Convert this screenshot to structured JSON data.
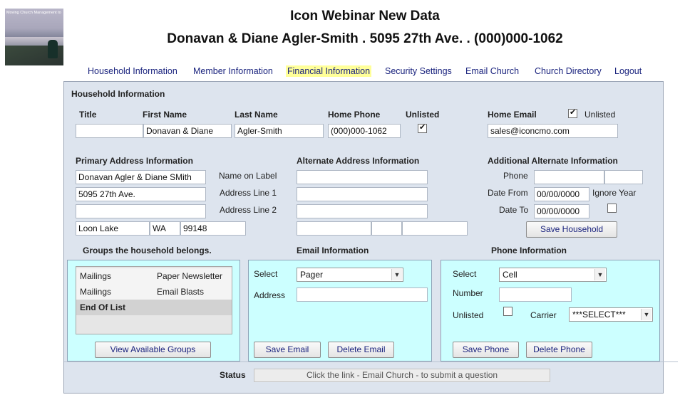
{
  "header": {
    "logo_caption": "Moving Church Management to a Higher Place",
    "title": "Icon Webinar New Data",
    "subtitle": "Donavan & Diane Agler-Smith . 5095 27th Ave. . (000)000-1062"
  },
  "nav": [
    {
      "label": "Household Information",
      "active": false
    },
    {
      "label": "Member Information",
      "active": false
    },
    {
      "label": "Financial Information",
      "active": true
    },
    {
      "label": "Security Settings",
      "active": false
    },
    {
      "label": "Email Church",
      "active": false
    },
    {
      "label": "Church Directory",
      "active": false
    },
    {
      "label": "Logout",
      "active": false
    }
  ],
  "household": {
    "section_title": "Household Information",
    "labels": {
      "title": "Title",
      "first_name": "First Name",
      "last_name": "Last Name",
      "home_phone": "Home Phone",
      "unlisted": "Unlisted",
      "home_email": "Home Email",
      "email_unlisted": "Unlisted"
    },
    "values": {
      "title": "",
      "first_name": "Donavan & Diane",
      "last_name": "Agler-Smith",
      "home_phone": "(000)000-1062",
      "phone_unlisted": true,
      "home_email": "sales@iconcmo.com",
      "email_unlisted": true
    }
  },
  "primary_address": {
    "section_title": "Primary Address Information",
    "name_on_label": "Donavan Agler & Diane SMith",
    "line1": "5095 27th Ave.",
    "line2": "",
    "city": "Loon Lake",
    "state": "WA",
    "zip": "99148"
  },
  "address_labels": {
    "name_on_label": "Name on Label",
    "line1": "Address Line 1",
    "line2": "Address Line 2"
  },
  "alternate_address": {
    "section_title": "Alternate Address Information",
    "name_on_label": "",
    "line1": "",
    "line2": "",
    "city": "",
    "state": "",
    "zip": ""
  },
  "additional_alternate": {
    "section_title": "Additional Alternate Information",
    "phone_label": "Phone",
    "phone": "",
    "phone_ext": "",
    "date_from_label": "Date From",
    "date_from": "00/00/0000",
    "ignore_year_label": "Ignore Year",
    "ignore_year": false,
    "date_to_label": "Date To",
    "date_to": "00/00/0000",
    "save_button": "Save Household"
  },
  "groups": {
    "section_title": "Groups the household belongs.",
    "rows": [
      {
        "group": "Mailings",
        "name": "Paper Newsletter"
      },
      {
        "group": "Mailings",
        "name": "Email Blasts"
      },
      {
        "group": "End Of List",
        "name": ""
      }
    ],
    "button": "View Available Groups"
  },
  "email_info": {
    "section_title": "Email Information",
    "select_label": "Select",
    "selected": "Pager",
    "address_label": "Address",
    "address": "",
    "save_button": "Save Email",
    "delete_button": "Delete Email"
  },
  "phone_info": {
    "section_title": "Phone Information",
    "select_label": "Select",
    "selected": "Cell",
    "number_label": "Number",
    "number": "",
    "unlisted_label": "Unlisted",
    "unlisted": false,
    "carrier_label": "Carrier",
    "carrier": "***SELECT***",
    "save_button": "Save Phone",
    "delete_button": "Delete Phone"
  },
  "status": {
    "label": "Status",
    "text": "Click the link - Email Church - to submit a question"
  },
  "colors": {
    "panel_bg": "#dde4ee",
    "box_bg": "#ccffff",
    "nav_text": "#1a237e",
    "nav_highlight": "#ffff99"
  }
}
